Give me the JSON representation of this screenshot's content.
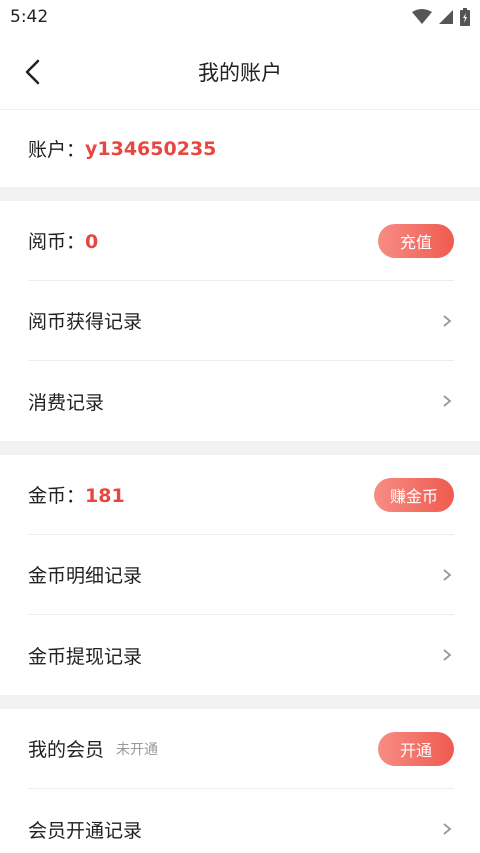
{
  "status": {
    "time": "5:42"
  },
  "header": {
    "title": "我的账户"
  },
  "account": {
    "label": "账户：",
    "value": "y134650235"
  },
  "read_coins": {
    "label": "阅币：",
    "value": "0",
    "button": "充值",
    "items": [
      "阅币获得记录",
      "消费记录"
    ]
  },
  "gold_coins": {
    "label": "金币：",
    "value": "181",
    "button": "赚金币",
    "items": [
      "金币明细记录",
      "金币提现记录"
    ]
  },
  "membership": {
    "label": "我的会员",
    "status": "未开通",
    "button": "开通",
    "items": [
      "会员开通记录"
    ]
  },
  "colors": {
    "accent": "#e8473f",
    "pill_start": "#f78d84",
    "pill_end": "#ef5a4f"
  }
}
